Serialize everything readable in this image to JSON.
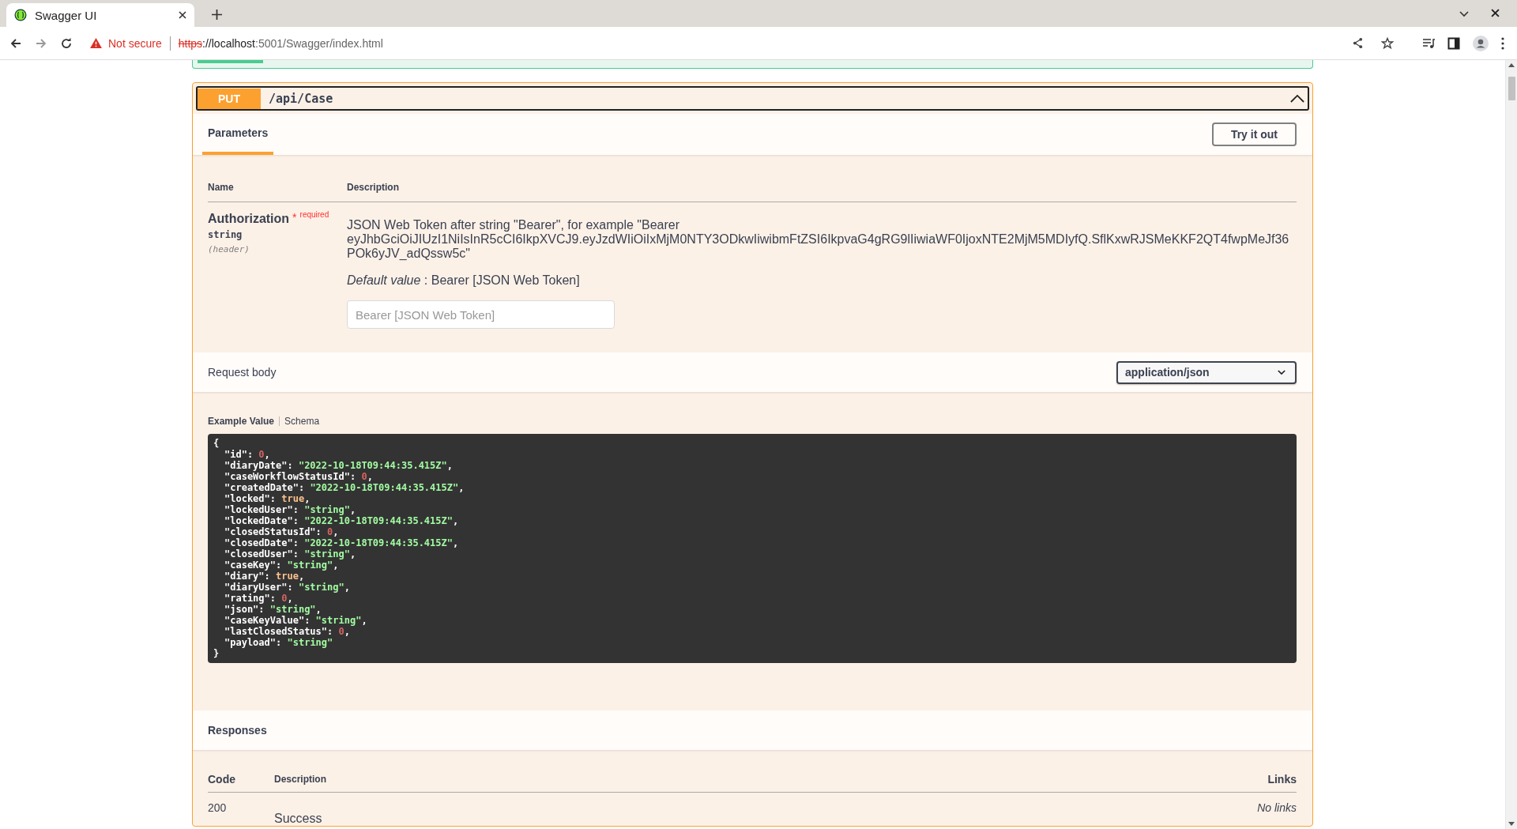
{
  "browser": {
    "tabs": [
      {
        "title": "Swagger UI",
        "selected": true
      }
    ],
    "security": "Not secure",
    "url": {
      "scheme": "https",
      "rest_host": "://localhost",
      "rest": ":5001/Swagger/index.html"
    }
  },
  "operation": {
    "method": "PUT",
    "path": "/api/Case",
    "expanded": true,
    "params_tab": "Parameters",
    "try_button": "Try it out",
    "param_columns": [
      "Name",
      "Description"
    ],
    "params": [
      {
        "name": "Authorization",
        "required_mark": "*",
        "required": "required",
        "type": "string",
        "location": "(header)",
        "description": "JSON Web Token after string \"Bearer\", for example \"Bearer eyJhbGciOiJIUzI1NiIsInR5cCI6IkpXVCJ9.eyJzdWIiOiIxMjM0NTY3ODkwIiwibmFtZSI6IkpvaG4gRG9lIiwiaWF0IjoxNTE2MjM5MDIyfQ.SflKxwRJSMeKKF2QT4fwpMeJf36POk6yJV_adQssw5c\"",
        "default_label": "Default value",
        "default_value": ": Bearer [JSON Web Token]",
        "placeholder": "Bearer [JSON Web Token]"
      }
    ],
    "request_body": {
      "label": "Request body",
      "content_type": "application/json",
      "tabs": [
        {
          "label": "Example Value",
          "selected": true
        },
        {
          "label": "Schema",
          "selected": false
        }
      ],
      "code": {
        "open": "{",
        "close": "}",
        "lines": [
          {
            "key": "\"id\":",
            "value": "0",
            "kind": "number",
            "end": ","
          },
          {
            "key": "\"diaryDate\":",
            "value": "\"2022-10-18T09:44:35.415Z\"",
            "kind": "string",
            "end": ","
          },
          {
            "key": "\"caseWorkflowStatusId\":",
            "value": "0",
            "kind": "number",
            "end": ","
          },
          {
            "key": "\"createdDate\":",
            "value": "\"2022-10-18T09:44:35.415Z\"",
            "kind": "string",
            "end": ","
          },
          {
            "key": "\"locked\":",
            "value": "true",
            "kind": "boolean",
            "end": ","
          },
          {
            "key": "\"lockedUser\":",
            "value": "\"string\"",
            "kind": "string",
            "end": ","
          },
          {
            "key": "\"lockedDate\":",
            "value": "\"2022-10-18T09:44:35.415Z\"",
            "kind": "string",
            "end": ","
          },
          {
            "key": "\"closedStatusId\":",
            "value": "0",
            "kind": "number",
            "end": ","
          },
          {
            "key": "\"closedDate\":",
            "value": "\"2022-10-18T09:44:35.415Z\"",
            "kind": "string",
            "end": ","
          },
          {
            "key": "\"closedUser\":",
            "value": "\"string\"",
            "kind": "string",
            "end": ","
          },
          {
            "key": "\"caseKey\":",
            "value": "\"string\"",
            "kind": "string",
            "end": ","
          },
          {
            "key": "\"diary\":",
            "value": "true",
            "kind": "boolean",
            "end": ","
          },
          {
            "key": "\"diaryUser\":",
            "value": "\"string\"",
            "kind": "string",
            "end": ","
          },
          {
            "key": "\"rating\":",
            "value": "0",
            "kind": "number",
            "end": ","
          },
          {
            "key": "\"json\":",
            "value": "\"string\"",
            "kind": "string",
            "end": ","
          },
          {
            "key": "\"caseKeyValue\":",
            "value": "\"string\"",
            "kind": "string",
            "end": ","
          },
          {
            "key": "\"lastClosedStatus\":",
            "value": "0",
            "kind": "number",
            "end": ","
          },
          {
            "key": "\"payload\":",
            "value": "\"string\"",
            "kind": "string"
          }
        ]
      }
    },
    "responses": {
      "title": "Responses",
      "columns": [
        "Code",
        "Description",
        "Links"
      ],
      "rows": [
        {
          "code": "200",
          "description": "Success",
          "links": "No links"
        }
      ]
    }
  }
}
